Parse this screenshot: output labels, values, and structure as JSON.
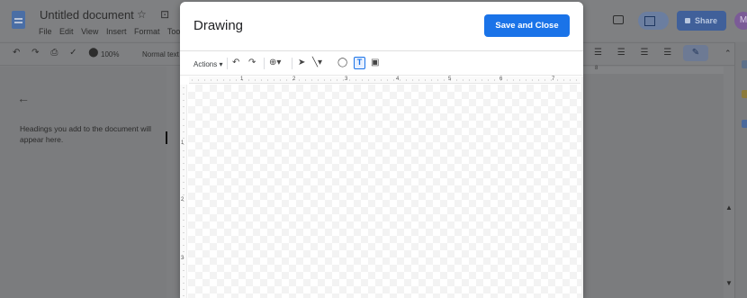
{
  "doc": {
    "title": "Untitled document",
    "title_icons": "☆ ⊡ ⊘",
    "menu": [
      "File",
      "Edit",
      "View",
      "Insert",
      "Format",
      "Too"
    ],
    "share_label": "Share",
    "avatar_initial": "M"
  },
  "toolbar": {
    "left_icons": "↶ ↷ ⎙ ✓ ⬤",
    "zoom": "100%",
    "style": "Normal text",
    "right_icons": "☰ ☰ ☰ ☰ ✕",
    "pen_icon": "✎",
    "collapse": "⌃"
  },
  "outline": {
    "back": "←",
    "hint": "Headings you add to the document will appear here."
  },
  "ruler": {
    "doc_mark": "8"
  },
  "dialog": {
    "title": "Drawing",
    "save_close": "Save and Close",
    "actions": "Actions ▾",
    "tools": {
      "undo": "↶",
      "redo": "↷",
      "zoom": "⊕▾",
      "select": "➤",
      "line": "╲▾",
      "shape": "◯",
      "textbox": "T",
      "image": "▣"
    },
    "h_ruler_numbers": [
      "1",
      "2",
      "3",
      "4",
      "5",
      "6",
      "7"
    ],
    "v_ruler_numbers": [
      "1",
      "2",
      "3"
    ]
  },
  "colors": {
    "accent": "#1a73e8",
    "overlay_bg": "#7d7e80"
  }
}
